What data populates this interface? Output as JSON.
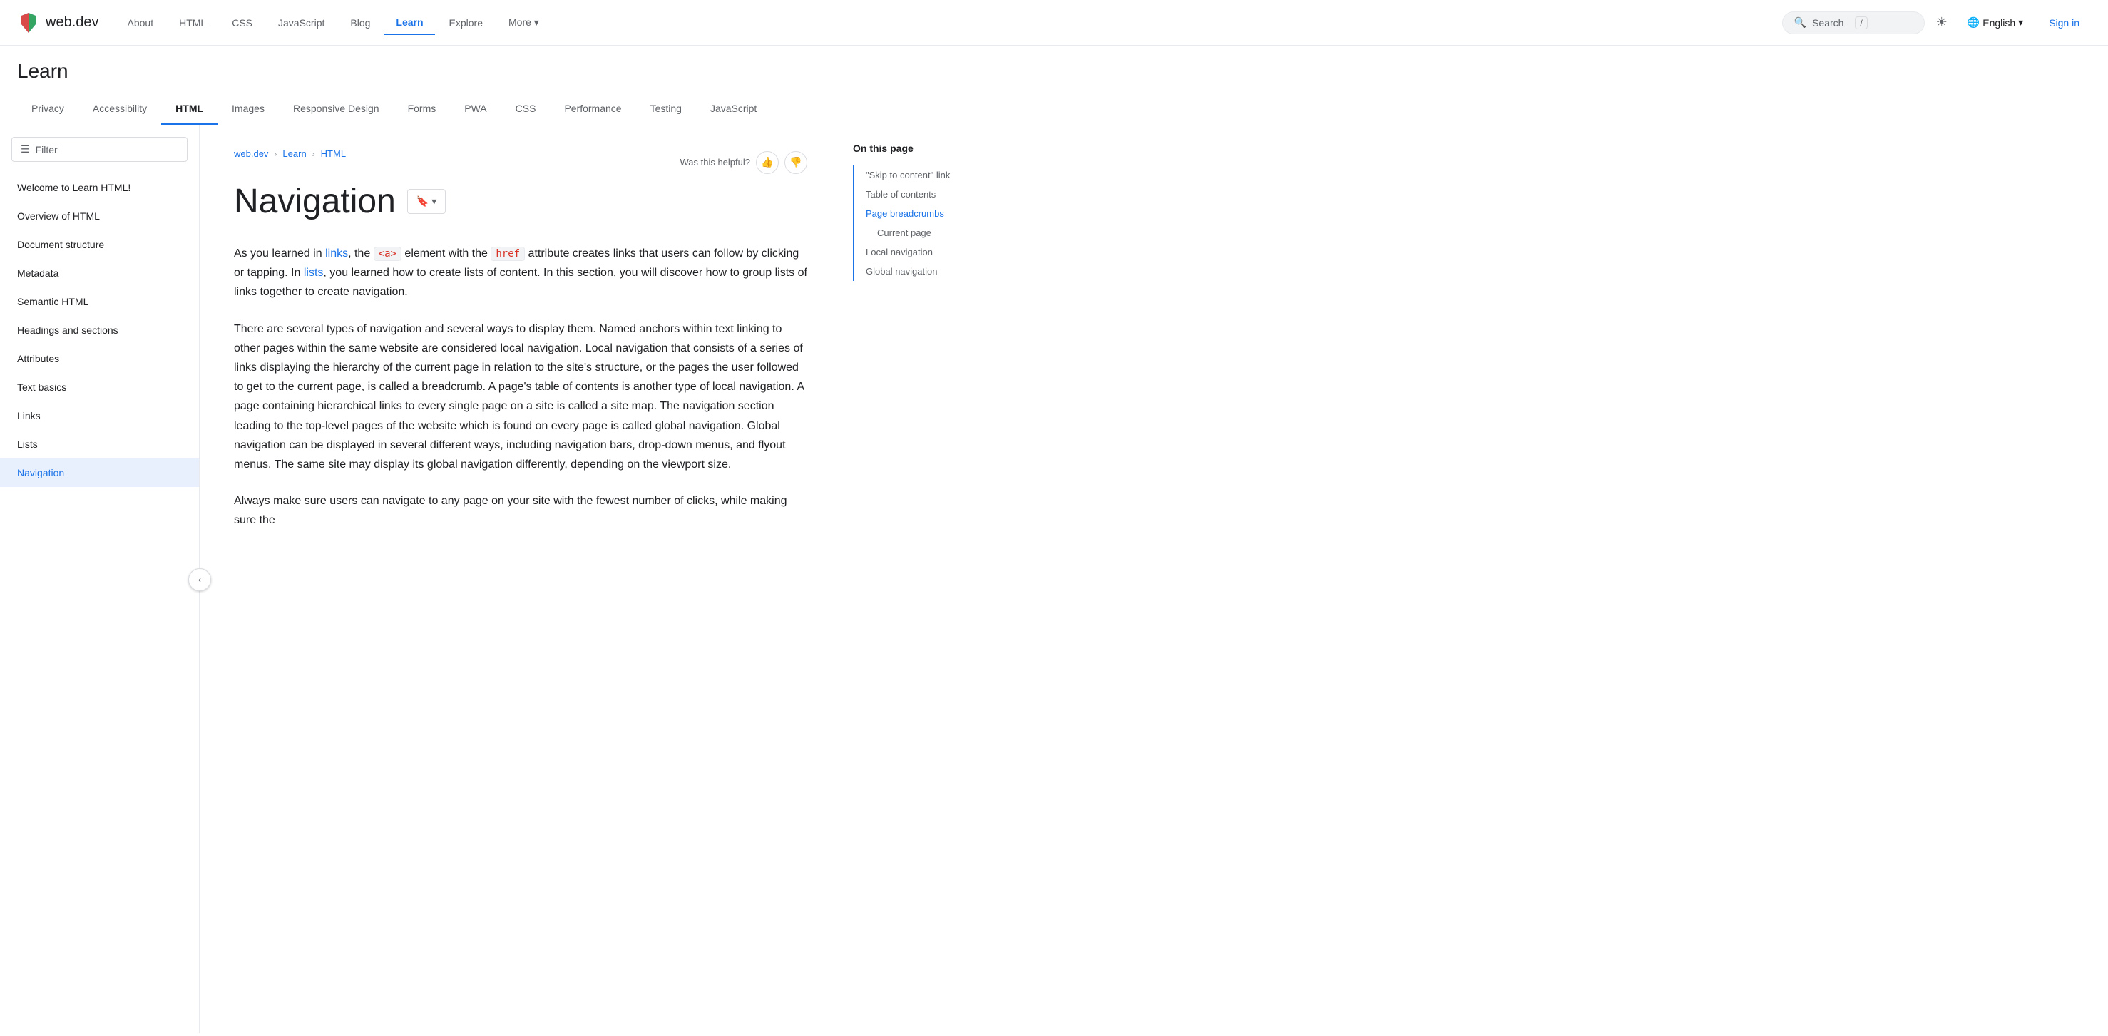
{
  "topNav": {
    "logo": "web.dev",
    "links": [
      {
        "label": "About",
        "active": false
      },
      {
        "label": "HTML",
        "active": false
      },
      {
        "label": "CSS",
        "active": false
      },
      {
        "label": "JavaScript",
        "active": false
      },
      {
        "label": "Blog",
        "active": false
      },
      {
        "label": "Learn",
        "active": true
      },
      {
        "label": "Explore",
        "active": false
      },
      {
        "label": "More ▾",
        "active": false
      }
    ],
    "search": {
      "placeholder": "Search",
      "slash": "/"
    },
    "language": "English",
    "signIn": "Sign in"
  },
  "learnHeader": {
    "title": "Learn",
    "tabs": [
      {
        "label": "Privacy",
        "active": false
      },
      {
        "label": "Accessibility",
        "active": false
      },
      {
        "label": "HTML",
        "active": true
      },
      {
        "label": "Images",
        "active": false
      },
      {
        "label": "Responsive Design",
        "active": false
      },
      {
        "label": "Forms",
        "active": false
      },
      {
        "label": "PWA",
        "active": false
      },
      {
        "label": "CSS",
        "active": false
      },
      {
        "label": "Performance",
        "active": false
      },
      {
        "label": "Testing",
        "active": false
      },
      {
        "label": "JavaScript",
        "active": false
      }
    ]
  },
  "sidebar": {
    "filter": "Filter",
    "items": [
      {
        "label": "Welcome to Learn HTML!",
        "active": false
      },
      {
        "label": "Overview of HTML",
        "active": false
      },
      {
        "label": "Document structure",
        "active": false
      },
      {
        "label": "Metadata",
        "active": false
      },
      {
        "label": "Semantic HTML",
        "active": false
      },
      {
        "label": "Headings and sections",
        "active": false
      },
      {
        "label": "Attributes",
        "active": false
      },
      {
        "label": "Text basics",
        "active": false
      },
      {
        "label": "Links",
        "active": false
      },
      {
        "label": "Lists",
        "active": false
      },
      {
        "label": "Navigation",
        "active": true
      }
    ]
  },
  "breadcrumb": {
    "items": [
      "web.dev",
      "Learn",
      "HTML"
    ]
  },
  "helpful": {
    "label": "Was this helpful?"
  },
  "page": {
    "title": "Navigation",
    "bookmark_label": "🔖",
    "dropdown_label": "▾"
  },
  "content": {
    "paragraph1": "As you learned in links, the <a> element with the href attribute creates links that users can follow by clicking or tapping. In lists, you learned how to create lists of content. In this section, you will discover how to group lists of links together to create navigation.",
    "paragraph2": "There are several types of navigation and several ways to display them. Named anchors within text linking to other pages within the same website are considered local navigation. Local navigation that consists of a series of links displaying the hierarchy of the current page in relation to the site's structure, or the pages the user followed to get to the current page, is called a breadcrumb. A page's table of contents is another type of local navigation. A page containing hierarchical links to every single page on a site is called a site map. The navigation section leading to the top-level pages of the website which is found on every page is called global navigation. Global navigation can be displayed in several different ways, including navigation bars, drop-down menus, and flyout menus. The same site may display its global navigation differently, depending on the viewport size.",
    "paragraph3": "Always make sure users can navigate to any page on your site with the fewest number of clicks, while making sure the"
  },
  "onThisPage": {
    "title": "On this page",
    "items": [
      {
        "label": "\"Skip to content\" link",
        "active": false,
        "indented": false
      },
      {
        "label": "Table of contents",
        "active": false,
        "indented": false
      },
      {
        "label": "Page breadcrumbs",
        "active": true,
        "indented": false
      },
      {
        "label": "Current page",
        "active": false,
        "indented": true
      },
      {
        "label": "Local navigation",
        "active": false,
        "indented": false
      },
      {
        "label": "Global navigation",
        "active": false,
        "indented": false
      }
    ]
  }
}
